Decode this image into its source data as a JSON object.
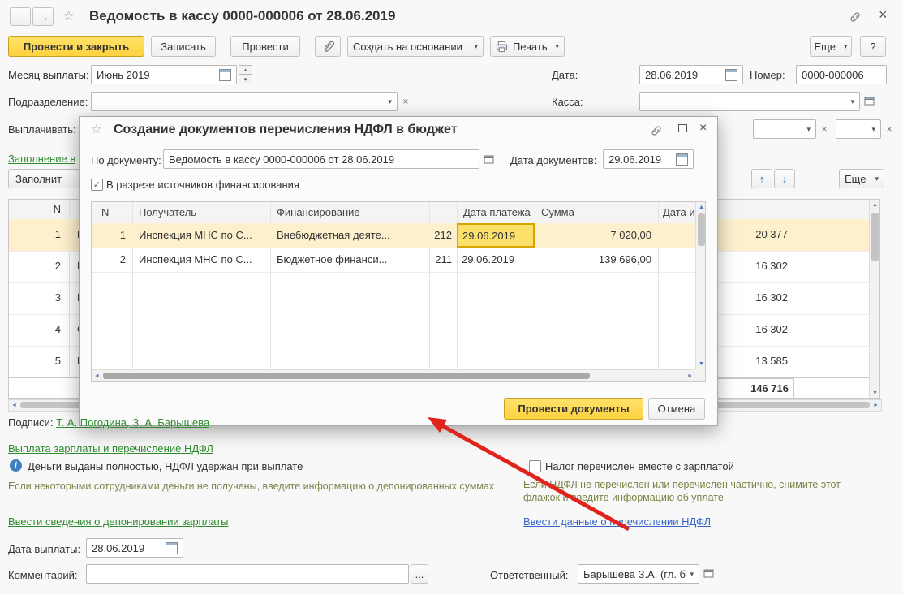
{
  "colors": {
    "accent_yellow": "#FFD942",
    "selected_row": "#FDF0CD",
    "selected_cell": "#FCE06C",
    "arrow_red": "#E0241B",
    "link_green": "#2E8B2E",
    "link_blue": "#3465C9",
    "hint_green": "#7A8447"
  },
  "icons": {
    "back": "←",
    "forward": "→",
    "star": "☆",
    "close": "×",
    "dropdown": "▾",
    "clear": "×",
    "spin_up": "▴",
    "spin_down": "▾",
    "move_up": "↑",
    "move_down": "↓",
    "check": "✓",
    "info": "i",
    "scroll_left": "◄",
    "scroll_right": "►",
    "scroll_up": "▲",
    "scroll_down": "▼"
  },
  "header": {
    "title": "Ведомость в кассу 0000-000006 от 28.06.2019"
  },
  "toolbar": {
    "post_and_close": "Провести и закрыть",
    "write": "Записать",
    "post": "Провести",
    "create_based_on": "Создать на основании",
    "print": "Печать",
    "more": "Еще",
    "help": "?"
  },
  "form": {
    "month_label": "Месяц выплаты:",
    "month_value": "Июнь 2019",
    "date_label": "Дата:",
    "date_value": "28.06.2019",
    "number_label": "Номер:",
    "number_value": "0000-000006",
    "department_label": "Подразделение:",
    "department_value": "",
    "cashbox_label": "Касса:",
    "cashbox_value": "",
    "pay_label": "Выплачивать:",
    "fill_link_fragment": "Заполнение в",
    "fill_button_fragment": "Заполнит"
  },
  "table": {
    "header_n": "N",
    "rows": [
      {
        "n": "1",
        "fragment": "П",
        "sum": "20 377"
      },
      {
        "n": "2",
        "fragment": "Р",
        "sum": "16 302"
      },
      {
        "n": "3",
        "fragment": "Р",
        "sum": "16 302"
      },
      {
        "n": "4",
        "fragment": "С",
        "sum": "16 302"
      },
      {
        "n": "5",
        "fragment": "Гр",
        "sum": "13 585"
      }
    ],
    "total": "146 716",
    "more_label": "Еще"
  },
  "dialog": {
    "title": "Создание документов перечисления НДФЛ в бюджет",
    "by_document_label": "По документу:",
    "by_document_value": "Ведомость в кассу 0000-000006 от 28.06.2019",
    "docs_date_label": "Дата документов:",
    "docs_date_value": "29.06.2019",
    "checkbox_label": "В разрезе источников финансирования",
    "checkbox_checked": true,
    "table": {
      "headers": [
        "N",
        "Получатель",
        "Финансирование",
        "",
        "Дата платежа",
        "Сумма",
        "Дата и н"
      ],
      "rows": [
        {
          "n": "1",
          "recipient": "Инспекция МНС по С...",
          "financing": "Внебюджетная деяте...",
          "code": "212",
          "pay_date": "29.06.2019",
          "sum": "7 020,00"
        },
        {
          "n": "2",
          "recipient": "Инспекция МНС по С...",
          "financing": "Бюджетное финанси...",
          "code": "211",
          "pay_date": "29.06.2019",
          "sum": "139 696,00"
        }
      ]
    },
    "post_documents_button": "Провести документы",
    "cancel_button": "Отмена"
  },
  "bottom": {
    "signatures_label": "Подписи:",
    "signatures_value": "Т. А. Погодина, З. А. Барышева",
    "salary_link": "Выплата зарплаты и перечисление НДФЛ",
    "info_text": "Деньги выданы полностью, НДФЛ удержан при выплате",
    "tax_checkbox_label": "Налог перечислен вместе с зарплатой",
    "left_hint": "Если некоторыми сотрудниками деньги не получены, введите информацию о депонированных суммах",
    "right_hint_line1": "Если НДФЛ не перечислен или перечислен частично, снимите этот",
    "right_hint_line2": "флажок и введите информацию об уплате",
    "deposit_link": "Ввести сведения о депонировании зарплаты",
    "ndfl_link": "Ввести данные о перечислении НДФЛ",
    "pay_date_label": "Дата выплаты:",
    "pay_date_value": "28.06.2019",
    "comment_label": "Комментарий:",
    "comment_value": "",
    "ellipsis_button": "...",
    "responsible_label": "Ответственный:",
    "responsible_value": "Барышева З.А. (гл. бухга"
  }
}
